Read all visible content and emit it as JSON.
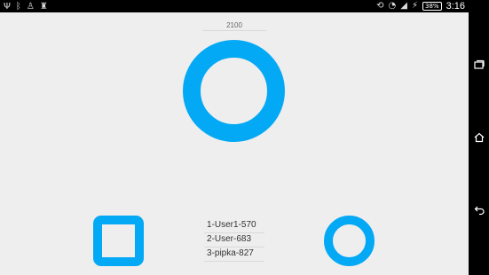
{
  "status_bar": {
    "left_icons": [
      "usb-icon",
      "bluetooth-icon",
      "notification-icon",
      "android-icon"
    ],
    "right_icons": [
      "rotate-icon",
      "wifi-icon",
      "signal-icon",
      "charging-icon"
    ],
    "battery_percent": "38%",
    "time": "3:16"
  },
  "game": {
    "score": "2100",
    "leaderboard": [
      "1-User1-570",
      "2-User-683",
      "3-pipka-827"
    ],
    "accent_color": "#03a9f4"
  },
  "nav_bar": {
    "buttons": [
      "recent-apps-icon",
      "home-icon",
      "back-icon"
    ]
  }
}
